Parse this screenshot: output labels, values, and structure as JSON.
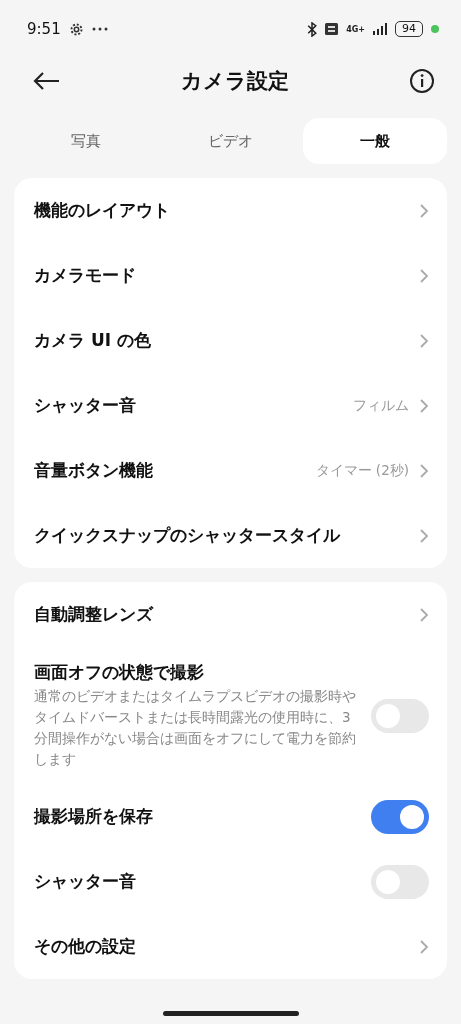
{
  "status_bar": {
    "time": "9:51",
    "network": "4G+",
    "battery": "94"
  },
  "header": {
    "title": "カメラ設定"
  },
  "tabs": [
    {
      "label": "写真",
      "selected": false
    },
    {
      "label": "ビデオ",
      "selected": false
    },
    {
      "label": "一般",
      "selected": true
    }
  ],
  "sections": [
    {
      "items": [
        {
          "kind": "link",
          "label": "機能のレイアウト"
        },
        {
          "kind": "link",
          "label": "カメラモード"
        },
        {
          "kind": "link",
          "label": "カメラ UI の色"
        },
        {
          "kind": "link",
          "label": "シャッター音",
          "value": "フィルム"
        },
        {
          "kind": "link",
          "label": "音量ボタン機能",
          "value": "タイマー (2秒)"
        },
        {
          "kind": "link",
          "label": "クイックスナップのシャッタースタイル"
        }
      ]
    },
    {
      "items": [
        {
          "kind": "link",
          "label": "自動調整レンズ"
        },
        {
          "kind": "toggle",
          "label": "画面オフの状態で撮影",
          "description": "通常のビデオまたはタイムラプスビデオの撮影時やタイムドバーストまたは長時間露光の使用時に、3分間操作がない場合は画面をオフにして電力を節約します",
          "on": false
        },
        {
          "kind": "toggle",
          "label": "撮影場所を保存",
          "on": true
        },
        {
          "kind": "toggle",
          "label": "シャッター音",
          "on": false
        },
        {
          "kind": "link",
          "label": "その他の設定"
        }
      ]
    }
  ]
}
